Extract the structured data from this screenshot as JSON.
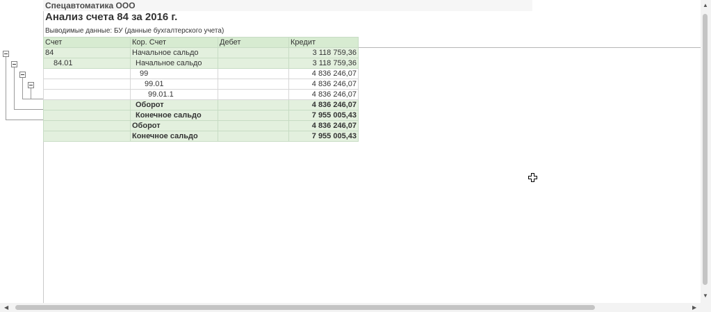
{
  "report": {
    "org": "Спецавтоматика ООО",
    "title": "Анализ счета 84 за 2016 г.",
    "subtitle": "Выводимые данные:  БУ (данные бухгалтерского учета)"
  },
  "table": {
    "headers": [
      "Счет",
      "Кор. Счет",
      "Дебет",
      "Кредит"
    ],
    "rows": [
      {
        "account": "84",
        "corr": "Начальное сальдо",
        "debit": "",
        "credit": "3 118 759,36"
      },
      {
        "account": "84.01",
        "corr": "Начальное сальдо",
        "debit": "",
        "credit": "3 118 759,36"
      },
      {
        "account": "",
        "corr": "99",
        "debit": "",
        "credit": "4 836 246,07"
      },
      {
        "account": "",
        "corr": "99.01",
        "debit": "",
        "credit": "4 836 246,07"
      },
      {
        "account": "",
        "corr": "99.01.1",
        "debit": "",
        "credit": "4 836 246,07"
      },
      {
        "account": "",
        "corr": "Оборот",
        "debit": "",
        "credit": "4 836 246,07"
      },
      {
        "account": "",
        "corr": "Конечное сальдо",
        "debit": "",
        "credit": "7 955 005,43"
      },
      {
        "account": "",
        "corr": "Оборот",
        "debit": "",
        "credit": "4 836 246,07"
      },
      {
        "account": "",
        "corr": "Конечное сальдо",
        "debit": "",
        "credit": "7 955 005,43"
      }
    ]
  },
  "icons": {
    "collapse": "minus-box-icon",
    "cursor": "move-cursor-icon",
    "arrows": [
      "arrow-up-icon",
      "arrow-down-icon",
      "arrow-left-icon",
      "arrow-right-icon"
    ]
  }
}
